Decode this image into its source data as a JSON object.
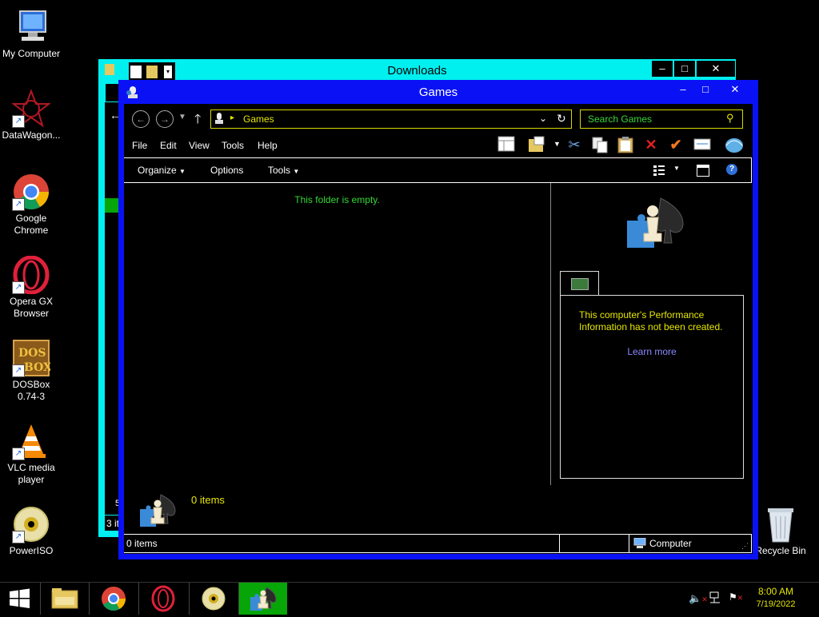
{
  "desktop": {
    "icons": [
      {
        "label": "My Computer"
      },
      {
        "label": "DataWagon..."
      },
      {
        "label": "Google Chrome"
      },
      {
        "label": "Opera GX Browser"
      },
      {
        "label": "DOSBox 0.74-3"
      },
      {
        "label": "VLC media player"
      },
      {
        "label": "PowerISO"
      },
      {
        "label": "Recycle Bin"
      }
    ]
  },
  "downloads_window": {
    "title": "Downloads",
    "status_text": "3 it",
    "fragment": "5"
  },
  "games_window": {
    "title": "Games",
    "address": {
      "path": "Games"
    },
    "search": {
      "placeholder": "Search Games"
    },
    "menu": [
      "File",
      "Edit",
      "View",
      "Tools",
      "Help"
    ],
    "commands": [
      "Organize",
      "Options",
      "Tools"
    ],
    "empty_message": "This folder is empty.",
    "details_count": "0 items",
    "preview": {
      "info_text": "This computer's Performance Information has not been created.",
      "learn_more": "Learn more"
    },
    "statusbar": {
      "items": "0 items",
      "location": "Computer"
    }
  },
  "taskbar": {
    "time": "8:00 AM",
    "date": "7/19/2022",
    "pinned": [
      "start-icon",
      "file-explorer-icon",
      "chrome-icon",
      "opera-icon",
      "poweriso-icon",
      "games-icon"
    ]
  },
  "colors": {
    "accent_cyan": "#00f0f0",
    "window_blue": "#0a12f5",
    "text_green": "#36d936",
    "text_yellow": "#e6e600",
    "link": "#8a8aff",
    "active_task": "#07a507"
  }
}
